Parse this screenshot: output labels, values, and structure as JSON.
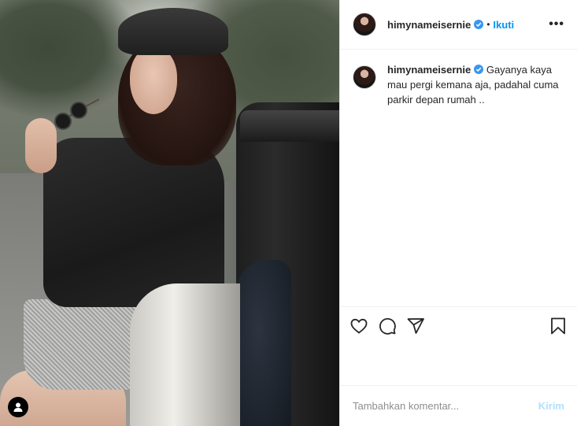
{
  "post": {
    "author": {
      "username": "himynameisernie",
      "verified": true
    },
    "header": {
      "separator": "•",
      "follow_label": "Ikuti",
      "more_label": "•••"
    },
    "caption": {
      "username": "himynameisernie",
      "text": "Gayanya kaya mau pergi kemana aja, padahal cuma parkir depan rumah .."
    },
    "actions": {
      "like": "heart-icon",
      "comment": "comment-icon",
      "share": "share-icon",
      "save": "bookmark-icon"
    },
    "comment_box": {
      "placeholder": "Tambahkan komentar...",
      "post_label": "Kirim"
    },
    "colors": {
      "accent": "#0095f6",
      "post_disabled": "#b2dffc",
      "text": "#262626",
      "muted": "#8e8e8e",
      "border": "#efefef"
    }
  }
}
